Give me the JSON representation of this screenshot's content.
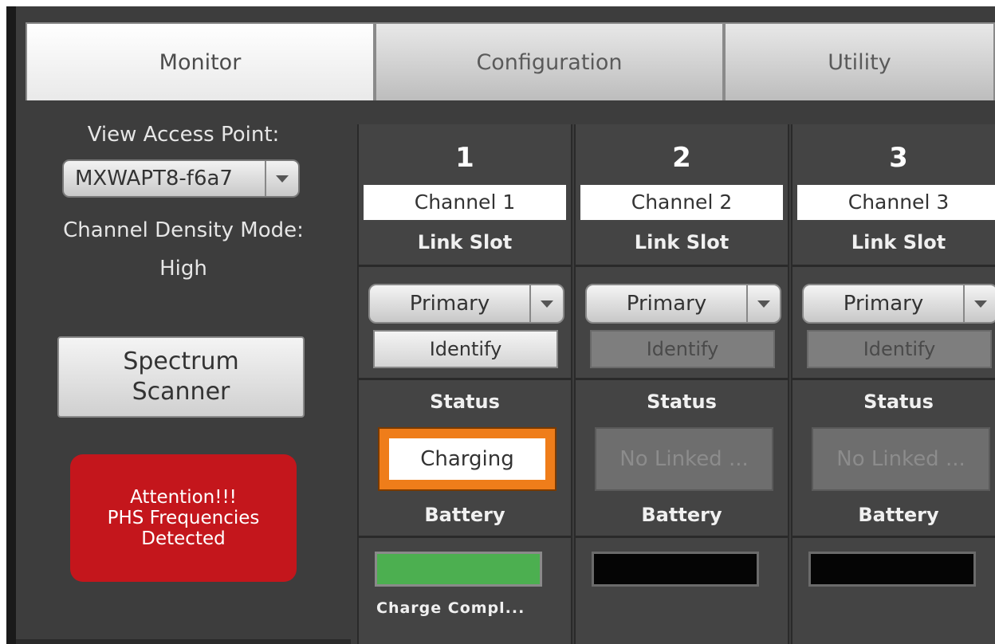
{
  "tabs": [
    "Monitor",
    "Configuration",
    "Utility"
  ],
  "active_tab": "Monitor",
  "left_panel": {
    "view_access_point_label": "View Access Point:",
    "access_point_value": "MXWAPT8-f6a7",
    "density_label": "Channel Density Mode:",
    "density_value": "High",
    "spectrum_button": "Spectrum\nScanner",
    "alert_text": "Attention!!!\nPHS Frequencies\nDetected"
  },
  "channels": [
    {
      "number": "1",
      "name": "Channel 1",
      "link_slot_label": "Link Slot",
      "slot_value": "Primary",
      "identify_label": "Identify",
      "identify_enabled": true,
      "status_label": "Status",
      "status_value": "Charging",
      "battery_label": "Battery",
      "battery_state": "green",
      "battery_text": "Charge Compl..."
    },
    {
      "number": "2",
      "name": "Channel 2",
      "link_slot_label": "Link Slot",
      "slot_value": "Primary",
      "identify_label": "Identify",
      "identify_enabled": false,
      "status_label": "Status",
      "status_value": "No Linked ...",
      "battery_label": "Battery",
      "battery_state": "black",
      "battery_text": ""
    },
    {
      "number": "3",
      "name": "Channel 3",
      "link_slot_label": "Link Slot",
      "slot_value": "Primary",
      "identify_label": "Identify",
      "identify_enabled": false,
      "status_label": "Status",
      "status_value": "No Linked ...",
      "battery_label": "Battery",
      "battery_state": "black",
      "battery_text": ""
    }
  ],
  "colors": {
    "alert_red": "#c4161c",
    "charging_orange": "#ef7d1a",
    "battery_green": "#4caf50"
  }
}
